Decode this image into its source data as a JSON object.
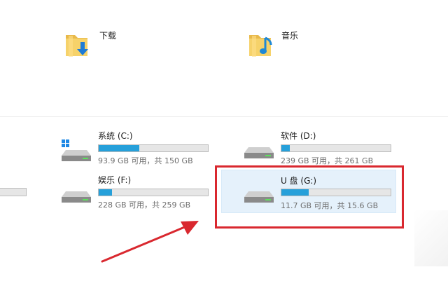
{
  "folders": [
    {
      "label": "下载",
      "icon": "download-folder-icon"
    },
    {
      "label": "音乐",
      "icon": "music-folder-icon"
    }
  ],
  "drives": [
    {
      "name": "系统 (C:)",
      "free_text": "93.9 GB 可用，共 150 GB",
      "used_fraction": 0.37,
      "icon": "windows-drive-icon"
    },
    {
      "name": "软件 (D:)",
      "free_text": "239 GB 可用，共 261 GB",
      "used_fraction": 0.08,
      "icon": "hard-drive-icon"
    },
    {
      "name": "娱乐 (F:)",
      "free_text": "228 GB 可用，共 259 GB",
      "used_fraction": 0.12,
      "icon": "hard-drive-icon"
    },
    {
      "name": "U 盘 (G:)",
      "free_text": "11.7 GB 可用，共 15.6 GB",
      "used_fraction": 0.25,
      "icon": "usb-drive-icon",
      "selected": true
    }
  ],
  "colors": {
    "usage_bar": "#26a0da",
    "selection": "#e5f1fb",
    "annotation": "#d9282f"
  }
}
